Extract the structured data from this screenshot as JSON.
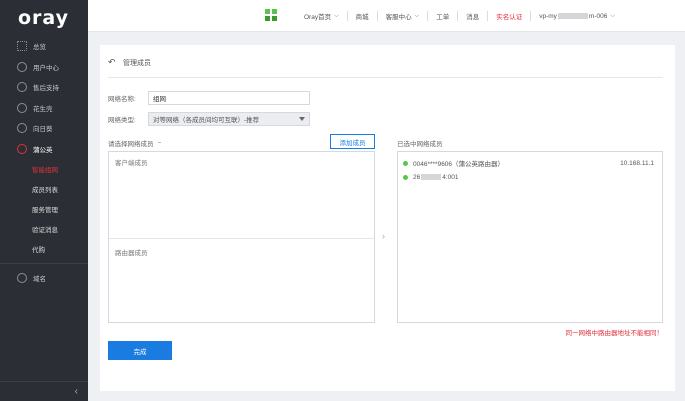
{
  "sidebar": {
    "logo": "oray",
    "items": [
      {
        "label": "总览",
        "icon": "grid-icon"
      },
      {
        "label": "用户中心",
        "icon": "user-icon"
      },
      {
        "label": "售后支持",
        "icon": "support-icon"
      },
      {
        "label": "花生壳",
        "icon": "peanut-icon"
      },
      {
        "label": "向日葵",
        "icon": "sunflower-icon"
      },
      {
        "label": "蒲公英",
        "icon": "dandelion-icon"
      }
    ],
    "subitems": [
      {
        "label": "智能组网"
      },
      {
        "label": "成员列表"
      },
      {
        "label": "服务管理"
      },
      {
        "label": "验证消息"
      },
      {
        "label": "代购"
      }
    ],
    "domain_item": {
      "label": "域名",
      "icon": "domain-icon"
    },
    "collapse_glyph": "‹"
  },
  "topbar": {
    "links": [
      {
        "label": "Oray首页",
        "dropdown": true
      },
      {
        "label": "商城",
        "dropdown": false
      },
      {
        "label": "客服中心",
        "dropdown": true
      },
      {
        "label": "工单",
        "dropdown": false
      },
      {
        "label": "消息",
        "dropdown": false
      },
      {
        "label": "实名认证",
        "dropdown": false,
        "color": "#e0313b"
      },
      {
        "label": "vp-my",
        "dropdown": false,
        "suffix": "m-006"
      }
    ]
  },
  "page": {
    "title": "管理成员",
    "network_name_label": "网络名称:",
    "network_name_value": "组网",
    "network_type_label": "网络类型:",
    "network_type_value": "对等网络（各成员间均可互联）-推荐",
    "pick_label": "请选择网络成员",
    "add_button": "添加成员",
    "client_members_title": "客户端成员",
    "router_members_title": "路由器成员",
    "selected_label": "已选中网络成员",
    "selected_members": [
      {
        "name": "0046****9606（蒲公英路由器）",
        "ip": "10.168.11.1"
      },
      {
        "name_prefix": "26",
        "name_suffix": "4:001",
        "ip": ""
      }
    ],
    "warning": "同一网络中路由器地址不能相同！",
    "done_button": "完成"
  },
  "colors": {
    "accent": "#1a7ce0",
    "danger": "#e0313b",
    "online": "#5ac54b",
    "sidebar_bg": "#2b2f35"
  }
}
